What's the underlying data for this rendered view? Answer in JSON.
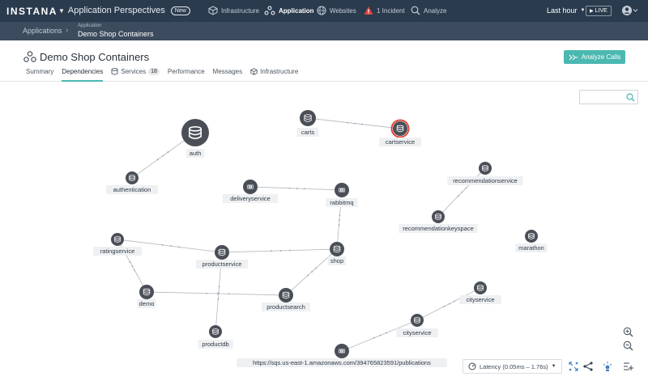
{
  "topnav": {
    "logo": "INSTANA",
    "perspectives": "Application Perspectives",
    "new_badge": "New",
    "items": [
      {
        "label": "Infrastructure",
        "icon": "cube-icon"
      },
      {
        "label": "Application",
        "icon": "app-icon"
      },
      {
        "label": "Websites",
        "icon": "globe-icon"
      },
      {
        "label": "1 Incident",
        "icon": "warning-icon"
      },
      {
        "label": "Analyze",
        "icon": "analyze-icon"
      }
    ],
    "time_range": "Last hour",
    "live": "LIVE"
  },
  "breadcrumb": {
    "root": "Applications",
    "current_kind": "Application",
    "current": "Demo Shop Containers"
  },
  "header": {
    "title": "Demo Shop Containers",
    "analyze_button": "Analyze Calls"
  },
  "tabs": [
    {
      "label": "Summary"
    },
    {
      "label": "Dependencies"
    },
    {
      "label": "Services",
      "count": "18"
    },
    {
      "label": "Performance"
    },
    {
      "label": "Messages"
    },
    {
      "label": "Infrastructure"
    }
  ],
  "graph": {
    "nodes": [
      {
        "id": "auth",
        "label": "auth",
        "type": "database"
      },
      {
        "id": "authentication",
        "label": "authentication",
        "type": "database"
      },
      {
        "id": "carts",
        "label": "carts",
        "type": "database"
      },
      {
        "id": "cartservice",
        "label": "cartservice",
        "type": "database",
        "status": "error"
      },
      {
        "id": "deliveryservice",
        "label": "deliveryservice",
        "type": "queue"
      },
      {
        "id": "rabbitmq",
        "label": "rabbitmq",
        "type": "queue"
      },
      {
        "id": "recommendationservice",
        "label": "recommendationservice",
        "type": "database"
      },
      {
        "id": "recommendationkeyspace",
        "label": "recommendationkeyspace",
        "type": "database"
      },
      {
        "id": "marathon",
        "label": "marathon",
        "type": "database"
      },
      {
        "id": "ratingservice",
        "label": "ratingservice",
        "type": "database"
      },
      {
        "id": "productservice",
        "label": "productservice",
        "type": "database"
      },
      {
        "id": "shop",
        "label": "shop",
        "type": "database"
      },
      {
        "id": "demo",
        "label": "demo",
        "type": "database"
      },
      {
        "id": "productsearch",
        "label": "productsearch",
        "type": "database"
      },
      {
        "id": "productdb",
        "label": "productdb",
        "type": "database"
      },
      {
        "id": "cityservice1",
        "label": "cityservice",
        "type": "database"
      },
      {
        "id": "cityservice2",
        "label": "cityservice",
        "type": "database"
      },
      {
        "id": "sqs",
        "label": "https://sqs.us-east-1.amazonaws.com/394765823591/publications",
        "type": "queue"
      }
    ],
    "edges": [
      [
        "auth",
        "authentication"
      ],
      [
        "carts",
        "cartservice"
      ],
      [
        "deliveryservice",
        "rabbitmq"
      ],
      [
        "recommendationkeyspace",
        "recommendationservice"
      ],
      [
        "rabbitmq",
        "shop"
      ],
      [
        "ratingservice",
        "productservice"
      ],
      [
        "productservice",
        "shop"
      ],
      [
        "ratingservice",
        "demo"
      ],
      [
        "demo",
        "productsearch"
      ],
      [
        "productsearch",
        "shop"
      ],
      [
        "productservice",
        "productdb"
      ],
      [
        "sqs",
        "cityservice2"
      ],
      [
        "cityservice2",
        "cityservice1"
      ]
    ]
  },
  "controls": {
    "latency": "Latency (0.05ms – 1.76s)"
  },
  "colors": {
    "nav_bg": "#2b3b4e",
    "subnav_bg": "#3c4b5d",
    "accent": "#4bb8b1",
    "node": "#4a4f57",
    "error": "#e0453b"
  }
}
